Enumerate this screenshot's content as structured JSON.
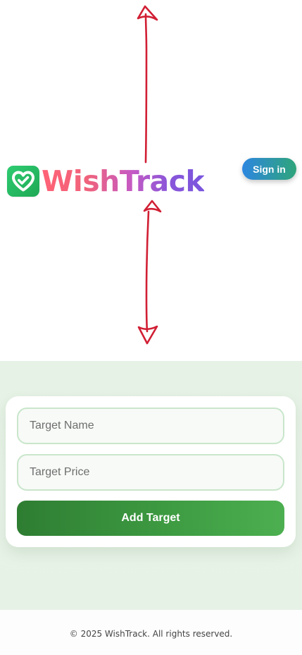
{
  "header": {
    "brand": {
      "name": "WishTrack",
      "icon": "heart-check-icon",
      "icon_color": "#27ae60",
      "text_gradient": [
        "#ff6275",
        "#7a55de"
      ]
    },
    "signin_label": "Sign in",
    "signin_gradient": [
      "#2d86e0",
      "#2fa57a"
    ]
  },
  "annotation": {
    "icon": "double-headed-arrow-annotation",
    "color": "#d11f34"
  },
  "form": {
    "name_placeholder": "Target Name",
    "price_placeholder": "Target Price",
    "submit_label": "Add Target",
    "submit_gradient": [
      "#2e7d32",
      "#4caf50"
    ]
  },
  "footer": {
    "copyright": "© 2025 WishTrack. All rights reserved."
  }
}
